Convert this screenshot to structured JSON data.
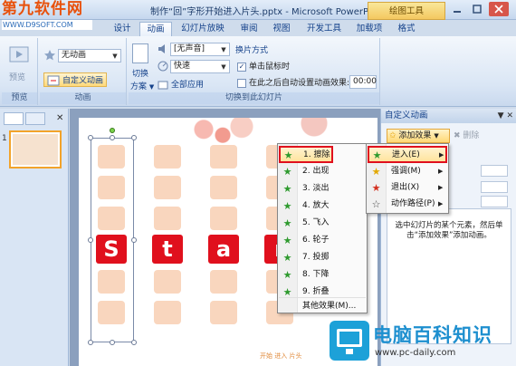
{
  "watermark_top": {
    "line1": "第九软件网",
    "line2": "WWW.D9SOFT.COM"
  },
  "window": {
    "title": "制作“回”字形开始进入片头.pptx - Microsoft PowerPoint",
    "context_tab": "绘图工具"
  },
  "tabs": [
    "设计",
    "动画",
    "幻灯片放映",
    "审阅",
    "视图",
    "开发工具",
    "加载项",
    "格式"
  ],
  "active_tab": "动画",
  "ribbon": {
    "preview": {
      "label": "预览",
      "group": "预览"
    },
    "animation": {
      "select_value": "无动画",
      "custom_button": "自定义动画",
      "group": "动画"
    },
    "transition": {
      "switch_label_1": "切换",
      "switch_label_2": "方案",
      "sound_value": "[无声音]",
      "speed_value": "快速",
      "apply_all": "全部应用",
      "advance_title": "换片方式",
      "on_click": "单击鼠标时",
      "auto_after": "在此之后自动设置动画效果:",
      "time_value": "00:00",
      "group": "切换到此幻灯片"
    }
  },
  "left_pane": {
    "slide_number": "1"
  },
  "slide": {
    "letters": [
      "S",
      "t",
      "a",
      "r"
    ],
    "footer": "开始 进入 片头"
  },
  "task_pane": {
    "title": "自定义动画",
    "add_effect": "添加效果",
    "remove": "删除",
    "hint": "选中幻灯片的某个元素，然后单击“添加效果”添加动画。"
  },
  "effects_menu": {
    "items": [
      {
        "label": "1. 擦除",
        "icon": "star-green"
      },
      {
        "label": "2. 出现",
        "icon": "star-green"
      },
      {
        "label": "3. 淡出",
        "icon": "star-green"
      },
      {
        "label": "4. 放大",
        "icon": "star-green"
      },
      {
        "label": "5. 飞入",
        "icon": "star-green"
      },
      {
        "label": "6. 轮子",
        "icon": "star-green"
      },
      {
        "label": "7. 投掷",
        "icon": "star-green"
      },
      {
        "label": "8. 下降",
        "icon": "star-green"
      },
      {
        "label": "9. 折叠",
        "icon": "star-green"
      }
    ],
    "more": "其他效果(M)..."
  },
  "add_effect_menu": {
    "items": [
      {
        "label": "进入(E)",
        "icon": "star-green"
      },
      {
        "label": "强调(M)",
        "icon": "star-yellow"
      },
      {
        "label": "退出(X)",
        "icon": "star-red"
      },
      {
        "label": "动作路径(P)",
        "icon": "star-outline"
      }
    ]
  },
  "watermark_bottom": {
    "title": "电脑百科知识",
    "url": "www.pc-daily.com"
  },
  "colors": {
    "accent_red": "#e0101d",
    "tile": "#f9d6be",
    "ribbon_text": "#15428b"
  }
}
